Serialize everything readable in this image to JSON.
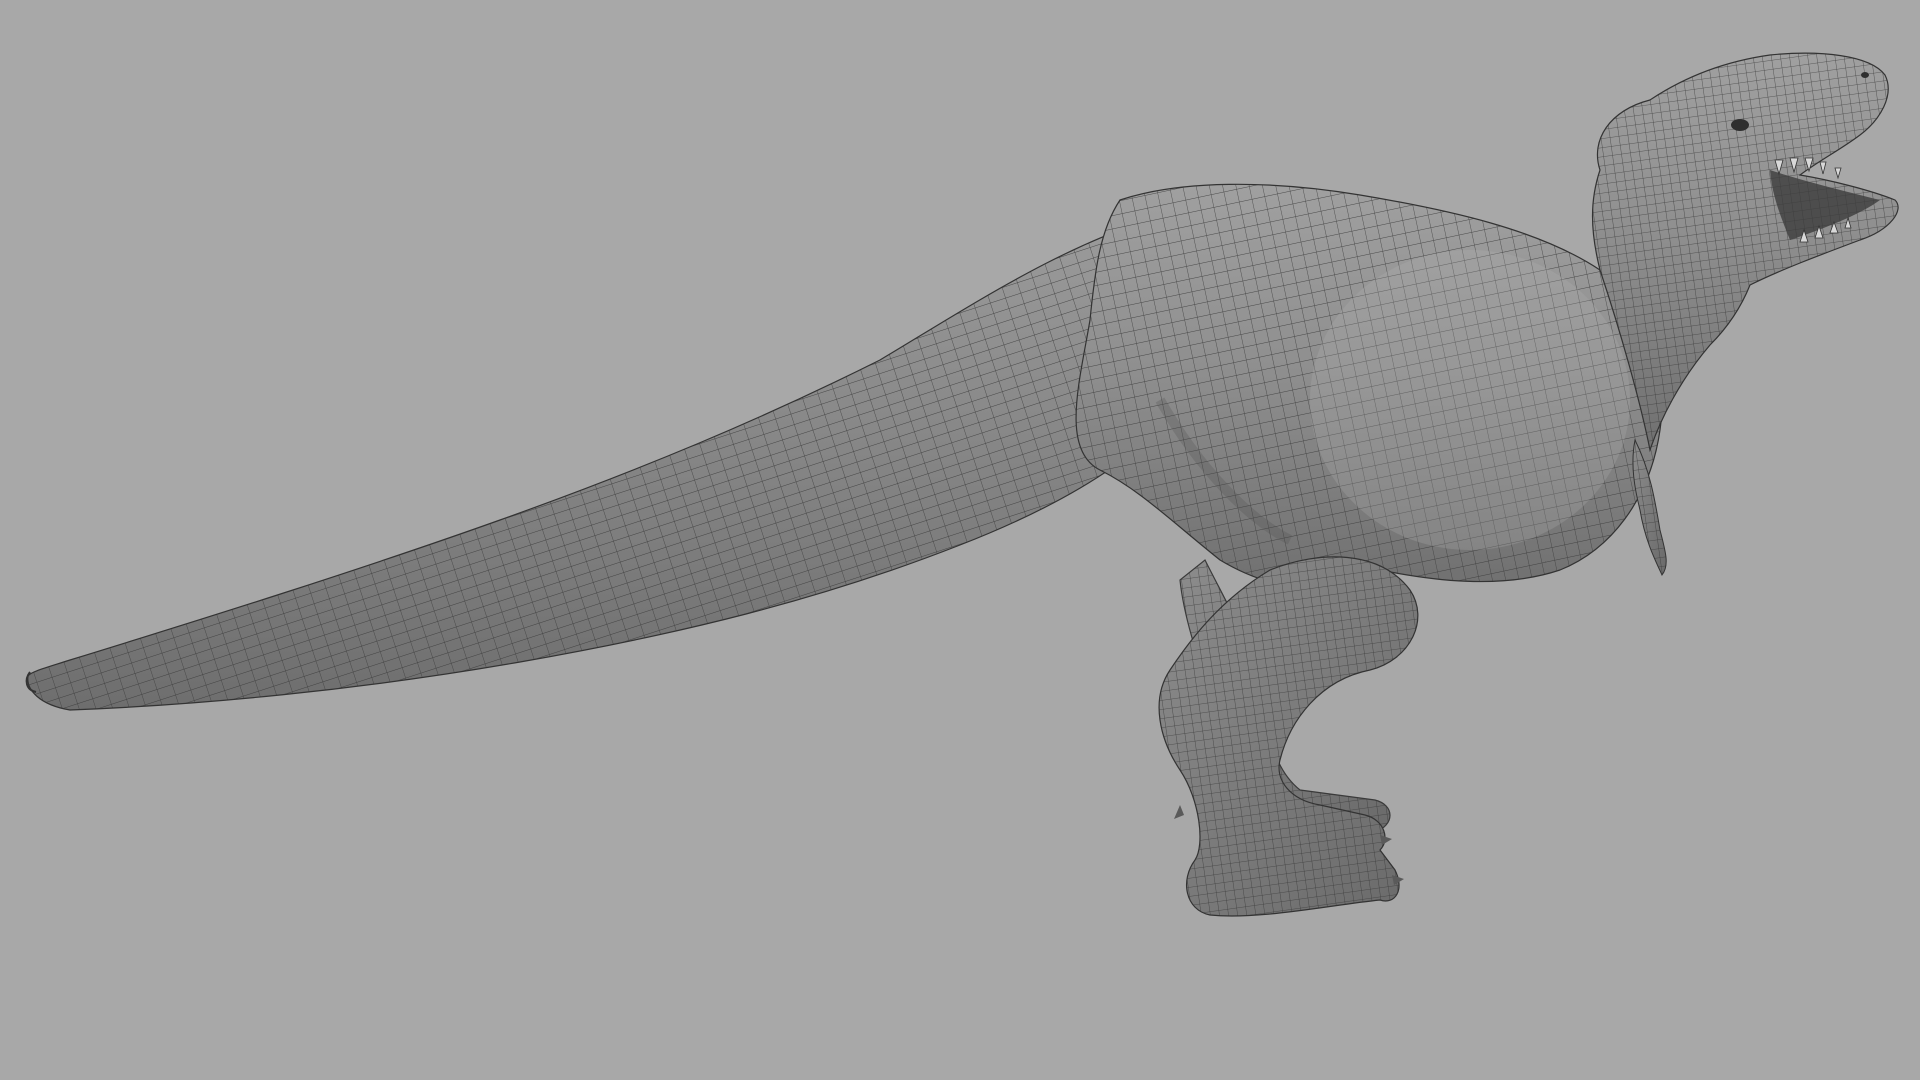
{
  "viewport": {
    "background_color": "#a8a8a8",
    "model": "t-rex-wireframe-mesh",
    "shading": "smooth-shaded-with-wireframe",
    "mesh_color": "#8e8e8e",
    "wire_color": "#3a3a3a",
    "icons": {
      "model": "dinosaur-icon"
    }
  }
}
